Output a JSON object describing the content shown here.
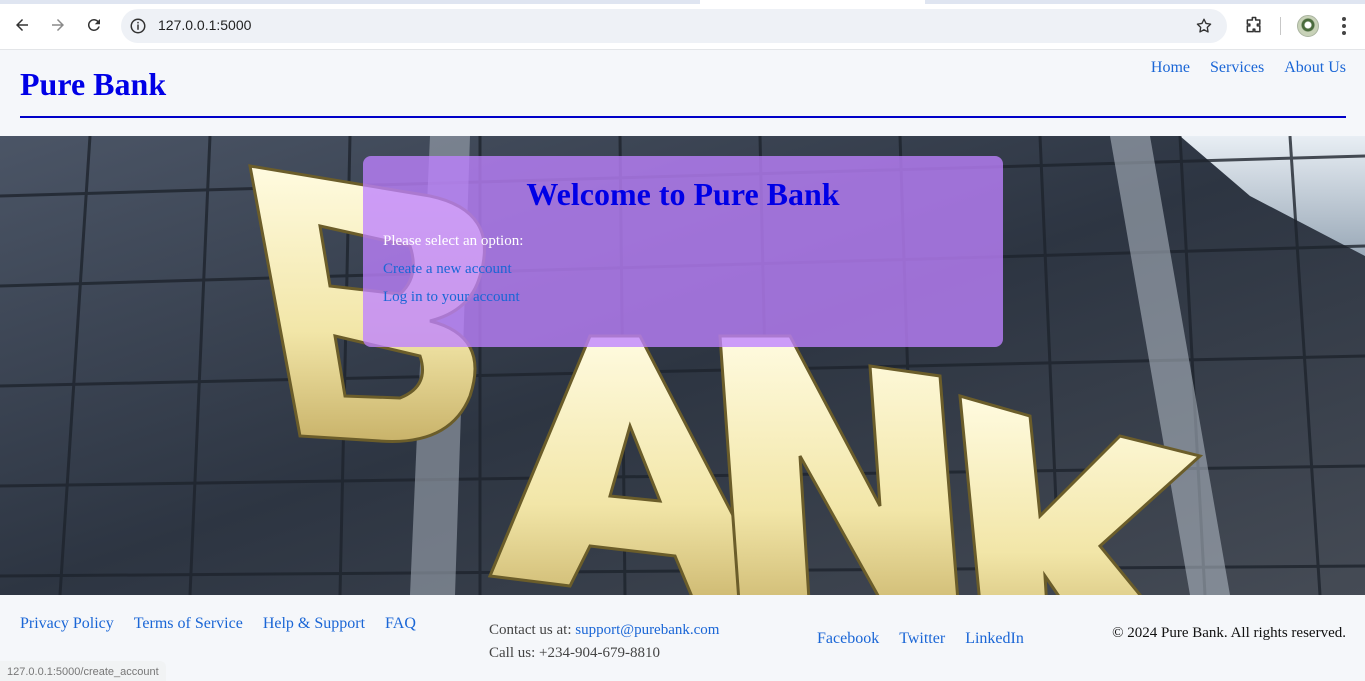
{
  "browser": {
    "url": "127.0.0.1:5000",
    "status_url": "127.0.0.1:5000/create_account",
    "icons": [
      "back-icon",
      "forward-icon",
      "reload-icon",
      "site-info-icon",
      "bookmark-star-icon",
      "extensions-icon",
      "profile-avatar",
      "menu-kebab-icon"
    ]
  },
  "header": {
    "brand": "Pure Bank",
    "nav": [
      "Home",
      "Services",
      "About Us"
    ]
  },
  "welcome": {
    "title": "Welcome to Pure Bank",
    "prompt": "Please select an option:",
    "options": [
      "Create a new account",
      "Log in to your account"
    ]
  },
  "footer": {
    "links": [
      "Privacy Policy",
      "Terms of Service",
      "Help & Support",
      "FAQ"
    ],
    "contact_label": "Contact us at:",
    "contact_email": "support@purebank.com",
    "phone": "Call us: +234-904-679-8810",
    "social": [
      "Facebook",
      "Twitter",
      "LinkedIn"
    ],
    "copyright": "© 2024 Pure Bank. All rights reserved."
  },
  "colors": {
    "brand": "#0000e6",
    "link": "#1a66d6",
    "card": "#be82ff",
    "rule": "#0000c8"
  }
}
